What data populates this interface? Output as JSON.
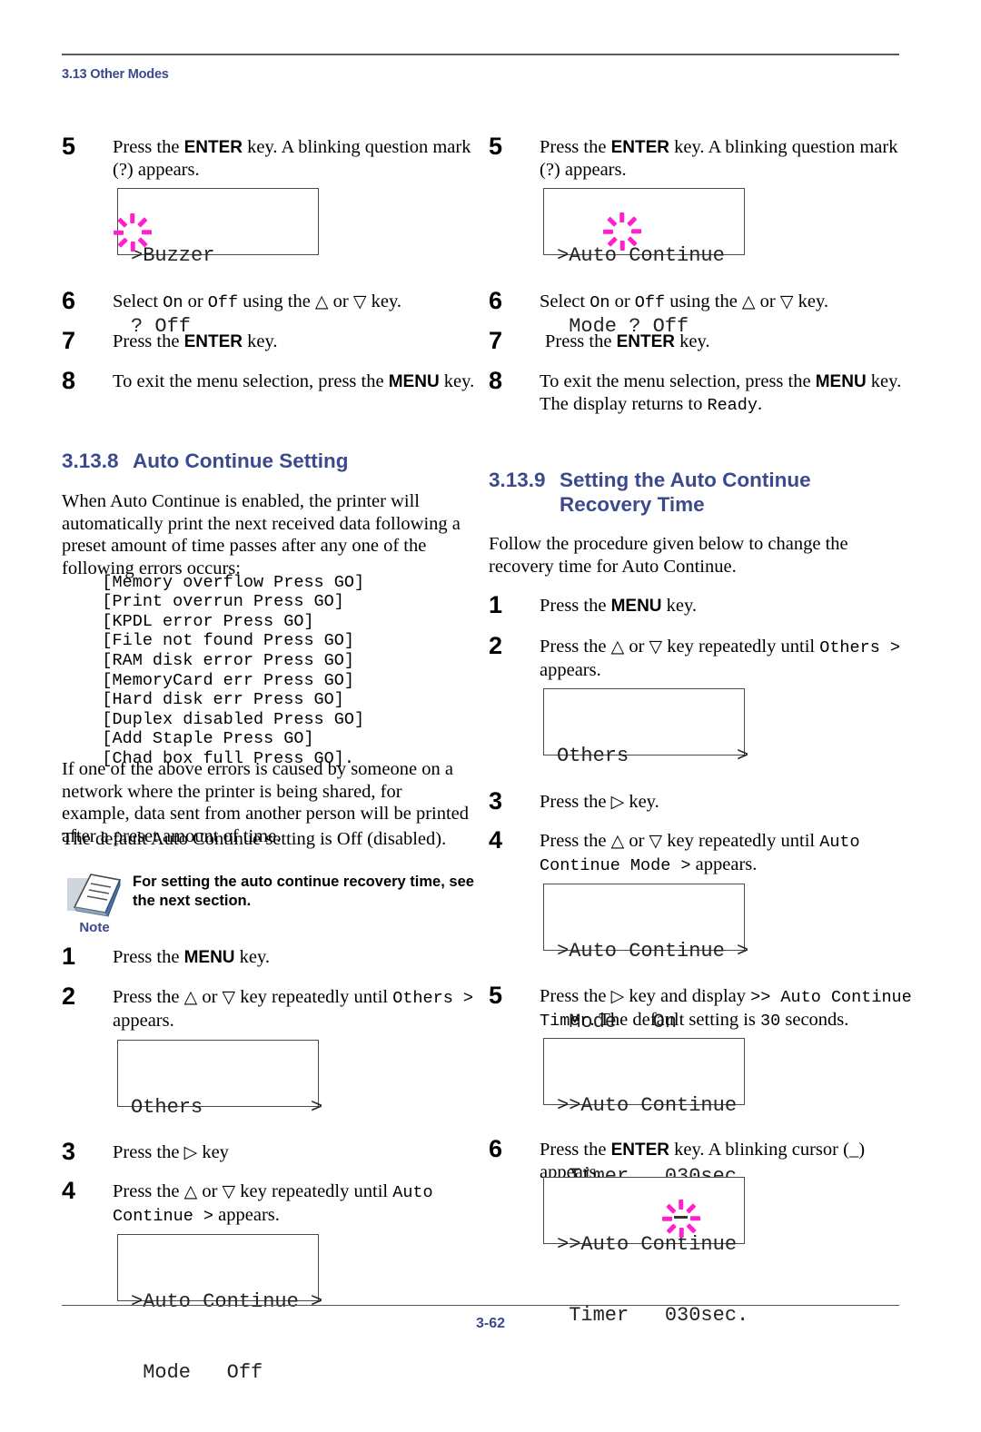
{
  "header": {
    "section_label": "3.13 Other Modes"
  },
  "footer": {
    "page_number": "3-62"
  },
  "colors": {
    "heading_blue": "#3b4a8c",
    "blink_magenta": "#ff22cc",
    "rule_gray": "#5a5a5a"
  },
  "left_column": {
    "steps_top": [
      {
        "num": "5",
        "text_parts": [
          "Press the ",
          "ENTER",
          " key. A blinking question mark (?) appears."
        ]
      },
      {
        "num": "6",
        "text_parts": [
          "Select ",
          "On",
          " or ",
          "Off",
          " using the ",
          "△",
          " or ",
          "▽",
          " key."
        ]
      },
      {
        "num": "7",
        "text_parts": [
          "Press the ",
          "ENTER",
          " key."
        ]
      },
      {
        "num": "8",
        "text_parts": [
          "To exit the menu selection, press the ",
          "MENU",
          " key."
        ]
      }
    ],
    "lcd_buzzer": {
      "line1": ">Buzzer",
      "line2": "? Off"
    },
    "heading": {
      "number": "3.13.8",
      "title": "Auto Continue Setting"
    },
    "intro_paragraph": "When Auto Continue is enabled, the printer will automatically print the next received data following a preset amount of time passes after any one of the following errors occurs:",
    "error_messages": [
      "[Memory overflow Press GO]",
      "[Print overrun Press GO]",
      "[KPDL error Press GO]",
      "[File not found Press GO]",
      "[RAM disk error Press GO]",
      "[MemoryCard err Press GO]",
      "[Hard disk err Press GO]",
      "[Duplex disabled Press GO]",
      "[Add Staple Press GO]",
      "[Chad box full Press GO]."
    ],
    "network_paragraph": "If one of the above errors is caused by someone on a network where the printer is being shared, for example, data sent from another person will be printed after a preset amount of time.",
    "default_paragraph": "The default Auto Continue setting is Off (disabled).",
    "note": {
      "caption": "Note",
      "icon": "note-document-icon",
      "text": "For setting the auto continue recovery time, see the next section."
    },
    "steps_bottom": [
      {
        "num": "1",
        "text_parts": [
          "Press the ",
          "MENU",
          " key."
        ]
      },
      {
        "num": "2",
        "text_parts": [
          "Press the ",
          "△",
          " or ",
          "▽",
          " key repeatedly until ",
          "Others >",
          " appears."
        ]
      },
      {
        "num": "3",
        "text_parts": [
          "Press the ",
          "▷",
          " key"
        ]
      },
      {
        "num": "4",
        "text_parts": [
          "Press the ",
          "△",
          " or ",
          "▽",
          " key repeatedly until ",
          "Auto Continue >",
          " appears."
        ]
      }
    ],
    "lcd_others": {
      "line1": "Others         >",
      "line2": ""
    },
    "lcd_auto_continue_off": {
      "line1": ">Auto Continue >",
      "line2": " Mode   Off"
    }
  },
  "right_column": {
    "steps_top": [
      {
        "num": "5",
        "text_parts": [
          "Press the ",
          "ENTER",
          " key. A blinking question mark (?) appears."
        ]
      },
      {
        "num": "6",
        "text_parts": [
          "Select ",
          "On",
          " or ",
          "Off",
          " using the ",
          "△",
          " or ",
          "▽",
          " key."
        ]
      },
      {
        "num": "7",
        "text_parts": [
          "Press the ",
          "ENTER",
          " key."
        ]
      },
      {
        "num": "8",
        "text_parts": [
          "To exit the menu selection, press the ",
          "MENU",
          " key. The display returns to ",
          "Ready",
          "."
        ]
      }
    ],
    "lcd_auto_continue_mode": {
      "line1": ">Auto Continue",
      "line2": " Mode ? Off"
    },
    "heading": {
      "number": "3.13.9",
      "title_line1": "Setting the Auto Continue",
      "title_line2": "Recovery Time"
    },
    "intro_paragraph": "Follow the procedure given below to change the recovery time for Auto Continue.",
    "steps": [
      {
        "num": "1",
        "text_parts": [
          "Press the ",
          "MENU",
          " key."
        ]
      },
      {
        "num": "2",
        "text_parts": [
          "Press the ",
          "△",
          " or ",
          "▽",
          " key repeatedly until ",
          "Others >",
          " appears."
        ]
      },
      {
        "num": "3",
        "text_parts": [
          "Press the ",
          "▷",
          " key."
        ]
      },
      {
        "num": "4",
        "text_parts": [
          "Press the ",
          "△",
          " or ",
          "▽",
          " key repeatedly until ",
          "Auto Continue Mode >",
          " appears."
        ]
      },
      {
        "num": "5",
        "text_parts": [
          "Press the ",
          "▷",
          " key and display ",
          ">> Auto Continue Timer",
          ". The default setting is ",
          "30",
          " seconds."
        ]
      },
      {
        "num": "6",
        "text_parts": [
          "Press the ",
          "ENTER",
          " key. A blinking cursor (_) appears."
        ]
      }
    ],
    "lcd_others": {
      "line1": "Others         >",
      "line2": ""
    },
    "lcd_auto_continue_on": {
      "line1": ">Auto Continue >",
      "line2": " Mode   On"
    },
    "lcd_timer": {
      "line1": ">>Auto Continue",
      "line2": " Timer   030sec."
    },
    "lcd_timer_cursor": {
      "line1": ">>Auto Continue",
      "line2": " Timer   030sec."
    }
  }
}
